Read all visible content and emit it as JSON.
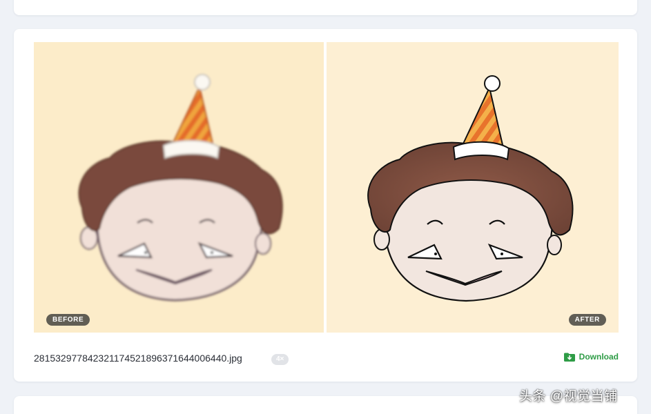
{
  "compare": {
    "before_label": "BEFORE",
    "after_label": "AFTER"
  },
  "file": {
    "name": "281532977842321174521896371644006440.jpg",
    "scale": "4×"
  },
  "actions": {
    "download_label": "Download",
    "download_icon": "folder-download-icon"
  },
  "watermark": {
    "text": "头条 @视觉当铺"
  },
  "colors": {
    "accent_green": "#2e9c46",
    "page_background": "#eff2f7",
    "image_background": "#fdebc9"
  }
}
